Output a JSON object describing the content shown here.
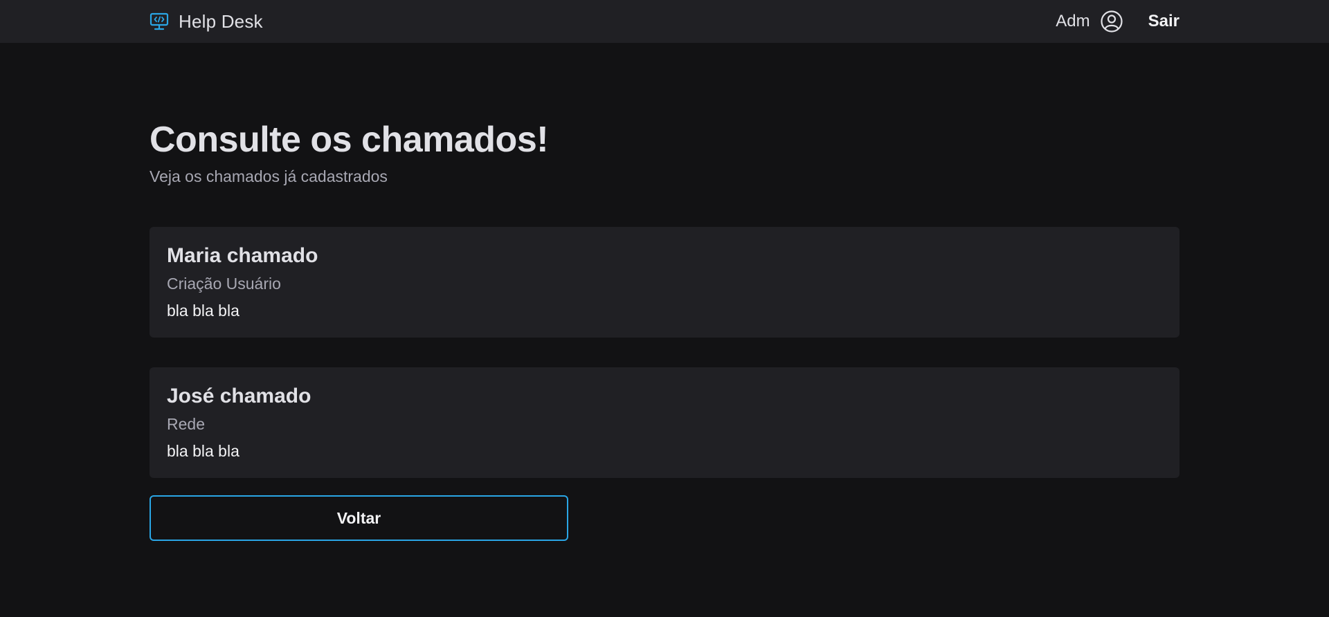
{
  "header": {
    "brand_title": "Help Desk",
    "brand_icon": "monitor-code-icon",
    "user_name": "Adm",
    "user_icon": "user-circle-icon",
    "logout_label": "Sair"
  },
  "page": {
    "title": "Consulte os chamados!",
    "subtitle": "Veja os chamados já cadastrados"
  },
  "tickets": [
    {
      "title": "Maria chamado",
      "category": "Criação Usuário",
      "description": "bla bla bla"
    },
    {
      "title": "José chamado",
      "category": "Rede",
      "description": "bla bla bla"
    }
  ],
  "actions": {
    "back_label": "Voltar"
  },
  "colors": {
    "background": "#121214",
    "surface": "#202024",
    "accent": "#2aa6e6",
    "text": "#e1e1e6",
    "muted_text": "#a8a8b3"
  }
}
